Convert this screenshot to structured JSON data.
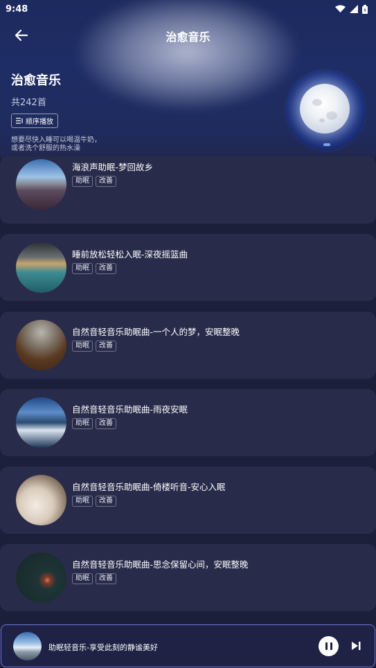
{
  "status_bar": {
    "time": "9:48"
  },
  "nav": {
    "title": "治愈音乐"
  },
  "playlist": {
    "title": "治愈音乐",
    "count": "共242首",
    "sequential_play_label": "顺序播放",
    "description_line1": "想要尽快入睡可以喝温牛奶，",
    "description_line2": "或者洗个舒服的热水澡"
  },
  "songs": [
    {
      "title": "海浪声助眠-梦回故乡",
      "tags": [
        "助眠",
        "改善"
      ]
    },
    {
      "title": "睡前放松轻松入眠-深夜摇篮曲",
      "tags": [
        "助眠",
        "改善"
      ]
    },
    {
      "title": "自然音轻音乐助眠曲-一个人的梦，安眠整晚",
      "tags": [
        "助眠",
        "改善"
      ]
    },
    {
      "title": "自然音轻音乐助眠曲-雨夜安眠",
      "tags": [
        "助眠",
        "改善"
      ]
    },
    {
      "title": "自然音轻音乐助眠曲-倚楼听音-安心入眠",
      "tags": [
        "助眠",
        "改善"
      ]
    },
    {
      "title": "自然音轻音乐助眠曲-思念保留心间，安眠整晚",
      "tags": [
        "助眠",
        "改善"
      ]
    }
  ],
  "player": {
    "now_playing": "助眠轻音乐-享受此刻的静谧美好"
  },
  "icons": {
    "back": "arrow-left-icon",
    "sequence": "sequence-icon",
    "pause": "pause-icon",
    "next": "skip-next-icon",
    "wifi": "wifi-icon",
    "signal": "signal-icon",
    "battery": "battery-icon"
  },
  "colors": {
    "background": "#1b1f3a",
    "card": "#292b4b",
    "accent_border": "#6f74d8"
  }
}
